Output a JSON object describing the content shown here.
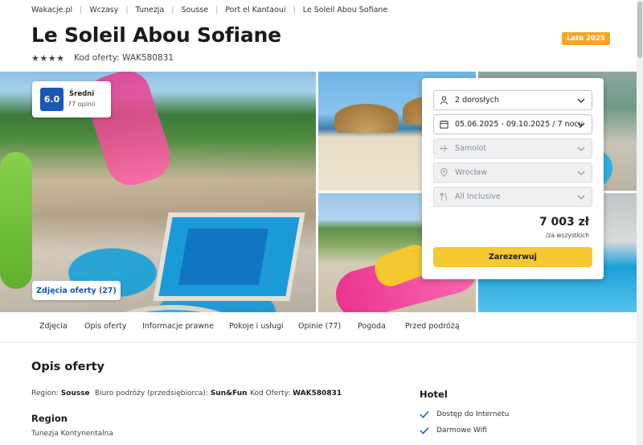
{
  "breadcrumb": [
    "Wakacje.pl",
    "Wczasy",
    "Tunezja",
    "Sousse",
    "Port el Kantaoui",
    "Le Soleil Abou Sofiane"
  ],
  "hotel": {
    "name": "Le Soleil Abou Sofiane",
    "stars": 4,
    "stars_text": "★★★★",
    "offer_code": "Kod oferty: WAK580831",
    "season_badge": "Lato 2025"
  },
  "rating": {
    "score": "6.0",
    "label": "Średni",
    "count": "77 opinii"
  },
  "gallery": {
    "photos_button": "Zdjęcia oferty (27)"
  },
  "booking": {
    "travelers": "2 dorosłych",
    "dates": "05.06.2025 - 09.10.2025 / 7 nocy",
    "transport": "Samolot",
    "departure": "Wrocław",
    "board": "All Inclusive",
    "price": "7 003 zł",
    "price_note": "/za wszystkich",
    "book_button": "Zarezerwuj"
  },
  "tabs": [
    "Zdjęcia",
    "Opis oferty",
    "Informacje prawne",
    "Pokoje i usługi",
    "Opinie (77)",
    "Pogoda",
    "Przed podróżą"
  ],
  "description": {
    "title": "Opis oferty",
    "region_label": "Region:",
    "region_value": "Sousse",
    "operator_label": "Biuro podróży (przedsiębiorca):",
    "operator_value": "Sun&Fun",
    "code_label": "Kod Oferty:",
    "code_value": "WAK580831",
    "region_heading": "Region",
    "region_text": "Tunezja Kontynentalna"
  },
  "hotel_features": {
    "title": "Hotel",
    "items": [
      "Dostęp do Internetu",
      "Darmowe Wifi"
    ]
  },
  "colors": {
    "accent": "#1a56b5",
    "cta": "#f7c82f",
    "badge": "#f5a623"
  }
}
